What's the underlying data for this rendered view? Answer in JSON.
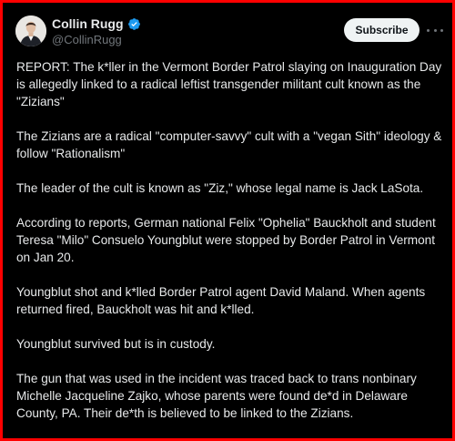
{
  "author": {
    "name": "Collin Rugg",
    "handle": "@CollinRugg",
    "verified_color": "#1d9bf0"
  },
  "header": {
    "subscribe_label": "Subscribe",
    "more_icon": "more-horizontal-icon"
  },
  "tweet": {
    "paragraphs": [
      "REPORT: The k*ller in the Vermont Border Patrol slaying on Inauguration Day is allegedly linked to a radical leftist transgender militant cult known as the \"Zizians\"",
      "The Zizians are a radical \"computer-savvy\" cult with a \"vegan Sith\" ideology & follow \"Rationalism\"",
      "The leader of the cult is known as \"Ziz,\" whose legal name is Jack LaSota.",
      "According to reports, German national Felix \"Ophelia\" Bauckholt and student Teresa \"Milo\" Consuelo Youngblut were stopped by Border Patrol in Vermont on Jan 20.",
      "Youngblut shot and k*lled Border Patrol agent David Maland. When agents returned fired, Bauckholt was hit and k*lled.",
      "Youngblut survived but is in custody.",
      "The gun that was used in the incident was traced back to trans nonbinary Michelle Jacqueline Zajko, whose parents were found de*d in Delaware County, PA. Their de*th is believed to be linked to the Zizians."
    ]
  },
  "colors": {
    "background": "#000000",
    "border": "#ff0000",
    "text": "#e7e9ea",
    "muted": "#71767b"
  }
}
